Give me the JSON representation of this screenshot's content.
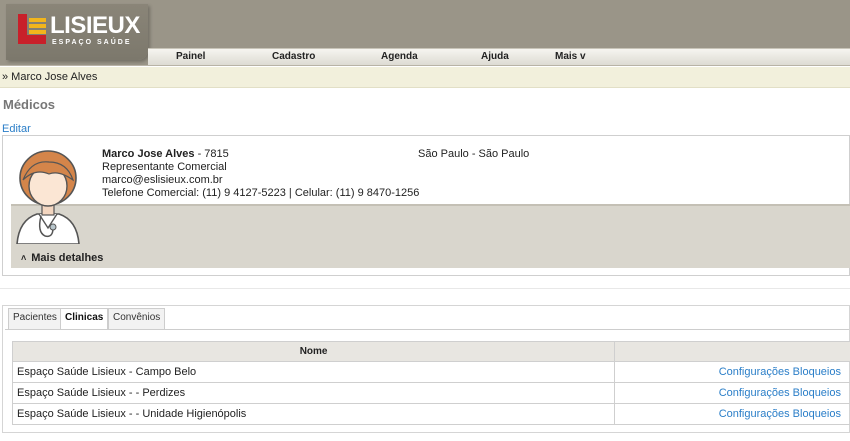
{
  "app": {
    "logo_text": "LISIEUX",
    "logo_subtitle": "ESPAÇO SAÚDE",
    "brand_red": "#c8202a",
    "brand_gold": "#f2b51c"
  },
  "nav": {
    "items": [
      {
        "label": "Painel"
      },
      {
        "label": "Cadastro"
      },
      {
        "label": "Agenda"
      },
      {
        "label": "Ajuda"
      },
      {
        "label": "Mais v"
      }
    ]
  },
  "breadcrumb": "» Marco Jose Alves",
  "page": {
    "title": "Médicos",
    "edit_label": "Editar"
  },
  "profile": {
    "name": "Marco Jose Alves",
    "id_suffix": " - 7815",
    "role": "Representante Comercial",
    "email": "marco@eslisieux.com.br",
    "phones": "Telefone Comercial: (11) 9 4127-5223 | Celular: (11) 9 8470-1256",
    "city": "São Paulo - São Paulo",
    "details_label": "Mais detalhes",
    "details_icon": "chevron-up-icon"
  },
  "tabs": [
    {
      "label": "Pacientes",
      "active": false
    },
    {
      "label": "Clinicas",
      "active": true
    },
    {
      "label": "Convênios",
      "active": false
    }
  ],
  "table": {
    "columns": [
      "Nome",
      ""
    ],
    "rows": [
      {
        "name": "Espaço Saúde Lisieux - Campo Belo",
        "action": "Configurações Bloqueios"
      },
      {
        "name": "Espaço Saúde Lisieux - - Perdizes",
        "action": "Configurações Bloqueios"
      },
      {
        "name": "Espaço Saúde Lisieux - - Unidade Higienópolis",
        "action": "Configurações Bloqueios"
      }
    ]
  },
  "colors": {
    "link": "#2a7ec8",
    "header_bg": "#9a9588",
    "crumb_bg": "#f2f0dc"
  }
}
